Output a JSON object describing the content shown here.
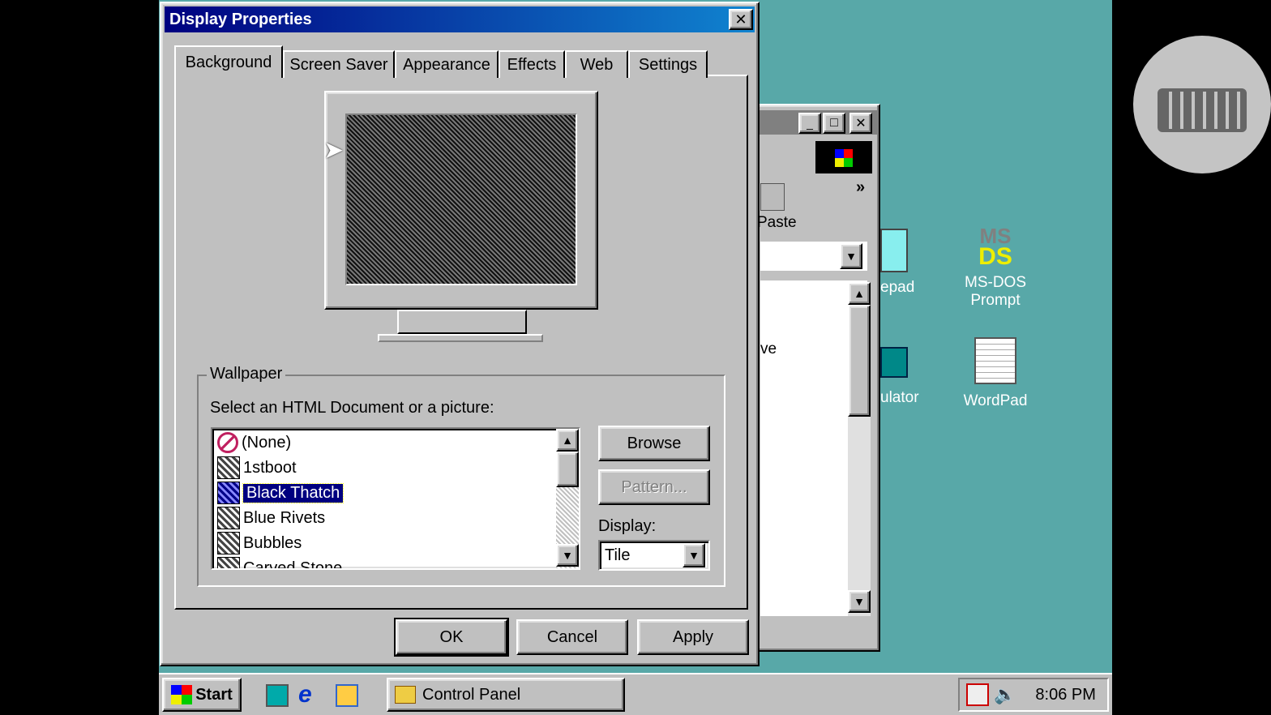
{
  "dialog": {
    "title": "Display Properties",
    "close_label": "✕",
    "tabs": [
      {
        "label": "Background"
      },
      {
        "label": "Screen Saver"
      },
      {
        "label": "Appearance"
      },
      {
        "label": "Effects"
      },
      {
        "label": "Web"
      },
      {
        "label": "Settings"
      }
    ],
    "active_tab": "Background",
    "wallpaper": {
      "group_label": "Wallpaper",
      "prompt": "Select an HTML Document or a picture:",
      "items": [
        {
          "label": "(None)"
        },
        {
          "label": "1stboot"
        },
        {
          "label": "Black Thatch"
        },
        {
          "label": "Blue Rivets"
        },
        {
          "label": "Bubbles"
        },
        {
          "label": "Carved Stone"
        }
      ],
      "selected": "Black Thatch"
    },
    "browse_label": "Browse",
    "pattern_label": "Pattern...",
    "display_label": "Display:",
    "display_value": "Tile",
    "ok_label": "OK",
    "cancel_label": "Cancel",
    "apply_label": "Apply"
  },
  "background_window": {
    "paste_label": "Paste",
    "chevron": "»",
    "partial_text": "ve"
  },
  "desktop_icons": [
    {
      "label": "MS-DOS Prompt"
    },
    {
      "label": "WordPad"
    },
    {
      "label": "epad"
    },
    {
      "label": "ulator"
    }
  ],
  "taskbar": {
    "start_label": "Start",
    "task_label": "Control Panel",
    "clock": "8:06 PM"
  },
  "colors": {
    "desktop": "#58a8a8",
    "titlebar": "#000080",
    "face": "#c0c0c0"
  }
}
